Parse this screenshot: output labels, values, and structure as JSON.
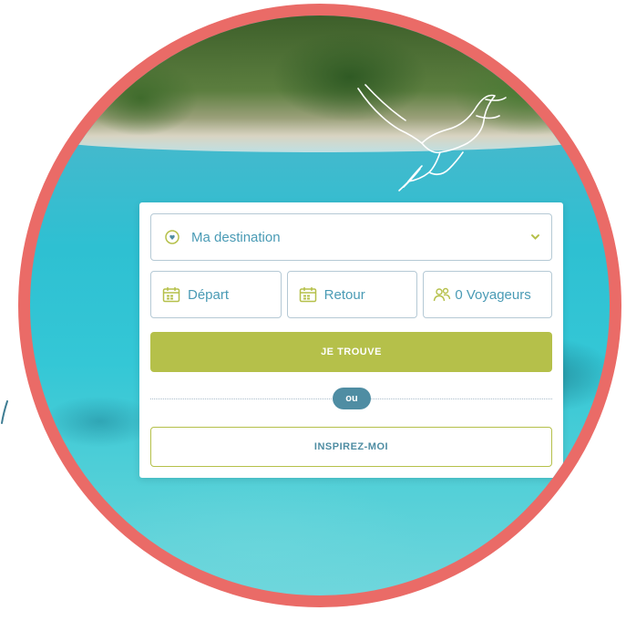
{
  "search": {
    "destination_label": "Ma destination",
    "departure_label": "Départ",
    "return_label": "Retour",
    "travelers_label": "0 Voyageurs",
    "find_button": "JE TROUVE",
    "divider_text": "ou",
    "inspire_button": "INSPIREZ-MOI"
  },
  "icons": {
    "destination": "location-heart-icon",
    "calendar": "calendar-icon",
    "travelers": "people-icon",
    "dropdown": "chevron-down-icon",
    "decoration": "bird-line-art-icon"
  },
  "colors": {
    "frame": "#ea6b67",
    "accent_green": "#b5c04a",
    "accent_blue": "#4f8da3",
    "text_blue": "#4a9bb5",
    "field_border": "#b5c9d5"
  }
}
